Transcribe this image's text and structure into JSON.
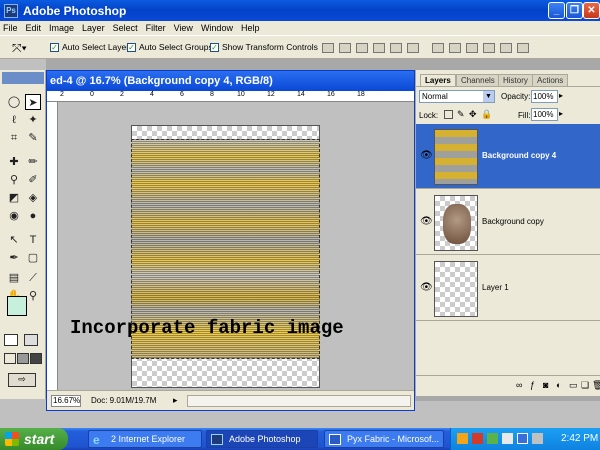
{
  "app": {
    "title": "Adobe Photoshop"
  },
  "menu": [
    "File",
    "Edit",
    "Image",
    "Layer",
    "Select",
    "Filter",
    "View",
    "Window",
    "Help"
  ],
  "options": {
    "auto_select_layer": "Auto Select Layer",
    "auto_select_groups": "Auto Select Groups",
    "show_transform_controls": "Show Transform Controls"
  },
  "document": {
    "title": "ed-4 @ 16.7% (Background copy 4, RGB/8)",
    "zoom": "16.67%",
    "doc_info": "Doc: 9.01M/19.7M",
    "overlay_text": "Incorporate fabric image",
    "ruler_marks": [
      "2",
      "0",
      "2",
      "4",
      "6",
      "8",
      "10",
      "12",
      "14",
      "16",
      "18"
    ]
  },
  "layers_palette": {
    "tabs": [
      "Layers",
      "Channels",
      "History",
      "Actions"
    ],
    "blend_mode": "Normal",
    "opacity_label": "Opacity:",
    "opacity": "100%",
    "lock_label": "Lock:",
    "fill_label": "Fill:",
    "fill": "100%",
    "layers": [
      {
        "name": "Background copy 4",
        "selected": true
      },
      {
        "name": "Background copy",
        "selected": false
      },
      {
        "name": "Layer 1",
        "selected": false
      }
    ]
  },
  "taskbar": {
    "start": "start",
    "buttons": [
      "2 Internet Explorer",
      "Adobe Photoshop",
      "Pyx Fabric - Microsof..."
    ],
    "clock": "2:42 PM"
  },
  "colors": {
    "accent": "#0a48d6",
    "selection": "#3266c8",
    "fabric_yellow": "#d9b22c"
  }
}
